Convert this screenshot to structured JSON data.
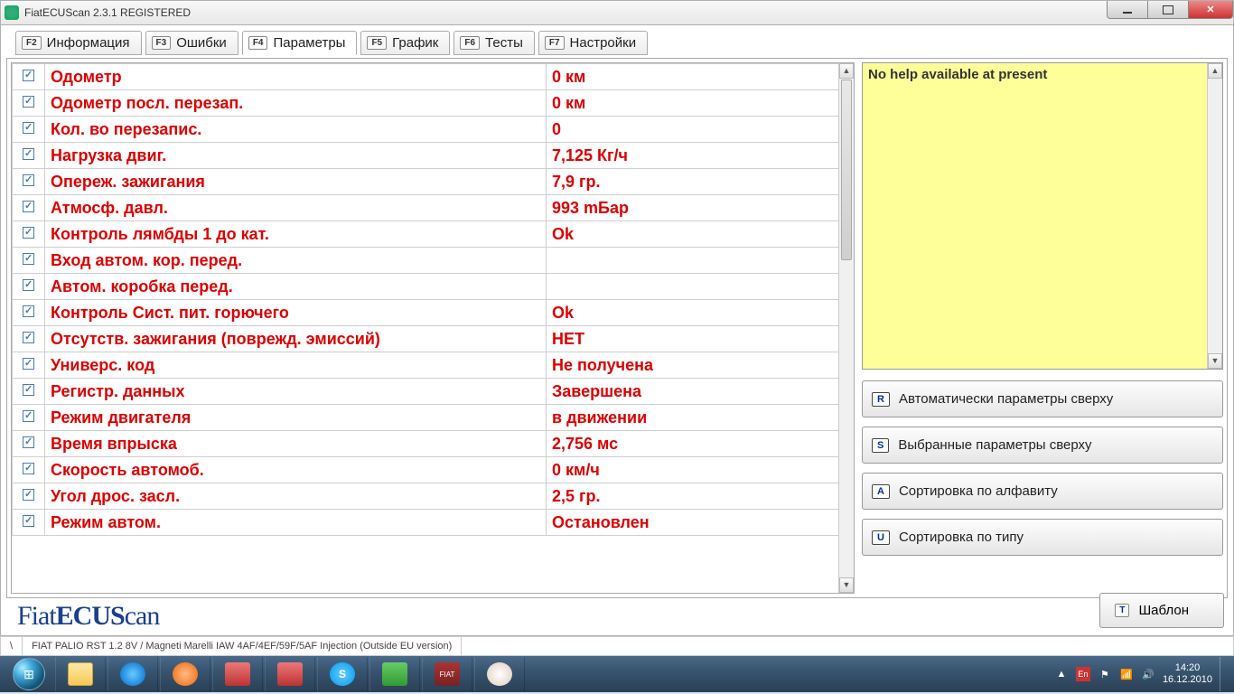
{
  "titlebar": {
    "text": "FiatECUScan 2.3.1 REGISTERED"
  },
  "tabs": [
    {
      "fkey": "F2",
      "label": "Информация"
    },
    {
      "fkey": "F3",
      "label": "Ошибки"
    },
    {
      "fkey": "F4",
      "label": "Параметры"
    },
    {
      "fkey": "F5",
      "label": "График"
    },
    {
      "fkey": "F6",
      "label": "Тесты"
    },
    {
      "fkey": "F7",
      "label": "Настройки"
    }
  ],
  "parameters": [
    {
      "name": "Одометр",
      "value": "0 км"
    },
    {
      "name": "Одометр посл. перезап.",
      "value": "0 км"
    },
    {
      "name": "Кол. во перезапис.",
      "value": "0"
    },
    {
      "name": "Нагрузка двиг.",
      "value": "7,125 Кг/ч"
    },
    {
      "name": "Опереж. зажигания",
      "value": "7,9 гр."
    },
    {
      "name": "Атмосф. давл.",
      "value": "993 mБар"
    },
    {
      "name": "Контроль лямбды 1 до кат.",
      "value": "Ok"
    },
    {
      "name": "Вход автом. кор. перед.",
      "value": ""
    },
    {
      "name": "Автом. коробка перед.",
      "value": ""
    },
    {
      "name": "Контроль Сист. пит. горючего",
      "value": "Ok"
    },
    {
      "name": "Отсутств. зажигания (поврежд. эмиссий)",
      "value": "НЕТ"
    },
    {
      "name": "Универс. код",
      "value": "Не получена"
    },
    {
      "name": "Регистр. данных",
      "value": "Завершена"
    },
    {
      "name": "Режим двигателя",
      "value": "в движении"
    },
    {
      "name": "Время впрыска",
      "value": "2,756 мс"
    },
    {
      "name": "Скорость автомоб.",
      "value": "0 км/ч"
    },
    {
      "name": "Угол дрос. засл.",
      "value": "2,5 гр."
    },
    {
      "name": "Режим автом.",
      "value": "Остановлен"
    }
  ],
  "help": {
    "text": "No help available at present"
  },
  "buttons": {
    "auto_top": {
      "key": "R",
      "label": "Автоматически параметры сверху"
    },
    "sel_top": {
      "key": "S",
      "label": "Выбранные параметры сверху"
    },
    "sort_alpha": {
      "key": "A",
      "label": "Сортировка по алфавиту"
    },
    "sort_type": {
      "key": "U",
      "label": "Сортировка по типу"
    },
    "template": {
      "key": "T",
      "label": "Шаблон"
    }
  },
  "logo_prefix": "Fiat",
  "logo_mid": "ECUS",
  "logo_suffix": "can",
  "status": {
    "path": "\\",
    "vehicle": "FIAT PALIO RST 1.2 8V / Magneti Marelli IAW 4AF/4EF/59F/5AF Injection (Outside EU version)"
  },
  "tray": {
    "lang": "En",
    "time": "14:20",
    "date": "16.12.2010"
  }
}
